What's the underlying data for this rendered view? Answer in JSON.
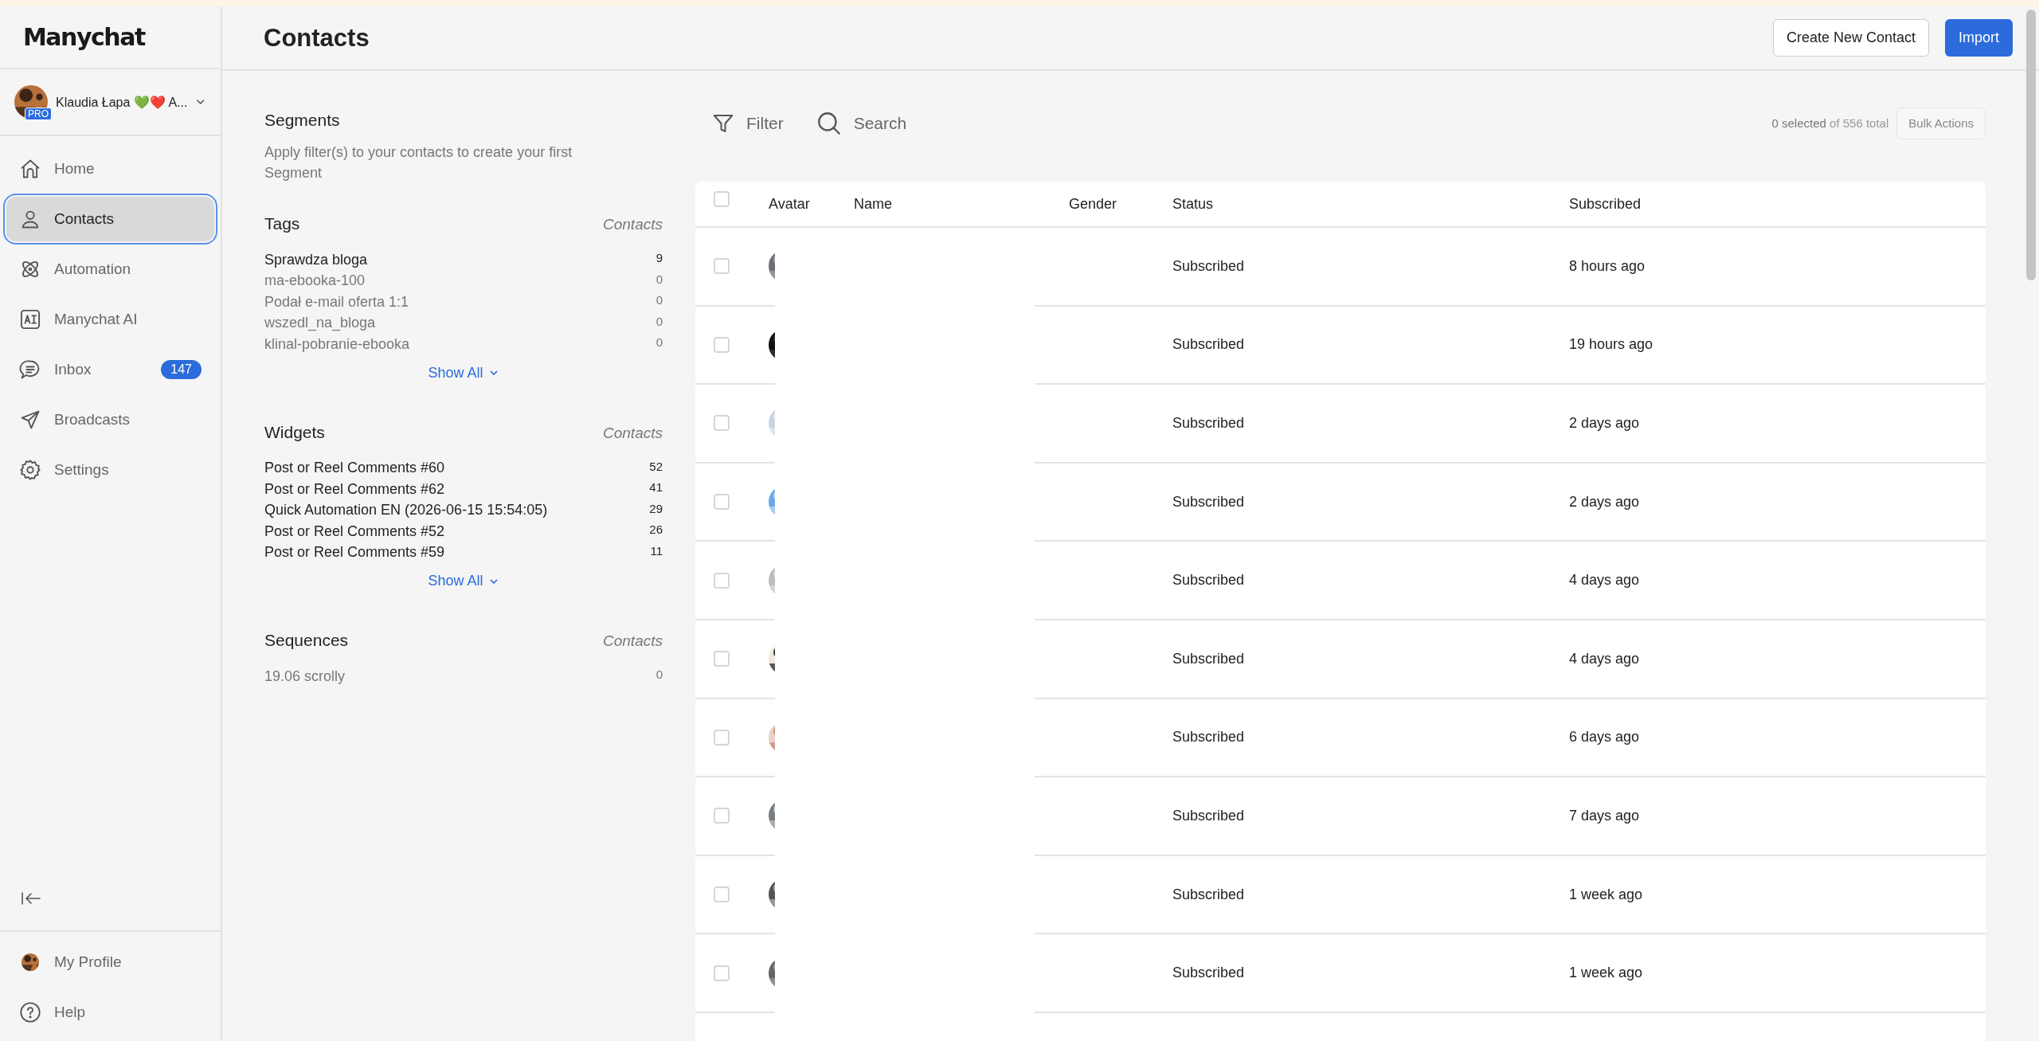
{
  "brand": {
    "logo": "Manychat"
  },
  "account": {
    "name": "Klaudia Łapa 💚❤️ A...",
    "badge": "PRO"
  },
  "nav": [
    {
      "label": "Home",
      "selected": false
    },
    {
      "label": "Contacts",
      "selected": true
    },
    {
      "label": "Automation",
      "selected": false
    },
    {
      "label": "Manychat AI",
      "selected": false
    },
    {
      "label": "Inbox",
      "selected": false,
      "badge": "147"
    },
    {
      "label": "Broadcasts",
      "selected": false
    },
    {
      "label": "Settings",
      "selected": false
    }
  ],
  "bottom_nav": [
    {
      "label": "My Profile"
    },
    {
      "label": "Help"
    }
  ],
  "header": {
    "title": "Contacts",
    "buttons": [
      {
        "label": "Create New Contact",
        "kind": "secondary"
      },
      {
        "label": "Import",
        "kind": "primary"
      }
    ]
  },
  "segments": {
    "title": "Segments",
    "hint": "Apply filter(s) to your contacts to create your first Segment"
  },
  "lists": [
    {
      "title": "Tags",
      "column": "Contacts",
      "show_all": "Show All",
      "items": [
        {
          "label": "Sprawdza bloga",
          "count": "9",
          "dimmed": false
        },
        {
          "label": "ma-ebooka-100",
          "count": "0",
          "dimmed": true
        },
        {
          "label": "Podał e-mail oferta 1:1",
          "count": "0",
          "dimmed": true
        },
        {
          "label": "wszedl_na_bloga",
          "count": "0",
          "dimmed": true
        },
        {
          "label": "klinal-pobranie-ebooka",
          "count": "0",
          "dimmed": true
        }
      ]
    },
    {
      "title": "Widgets",
      "column": "Contacts",
      "show_all": "Show All",
      "items": [
        {
          "label": "Post or Reel Comments #60",
          "count": "52",
          "dimmed": false
        },
        {
          "label": "Post or Reel Comments #62",
          "count": "41",
          "dimmed": false
        },
        {
          "label": "Quick Automation EN (2026-06-15 15:54:05)",
          "count": "29",
          "dimmed": false
        },
        {
          "label": "Post or Reel Comments #52",
          "count": "26",
          "dimmed": false
        },
        {
          "label": "Post or Reel Comments #59",
          "count": "11",
          "dimmed": false
        }
      ]
    },
    {
      "title": "Sequences",
      "column": "Contacts",
      "items": [
        {
          "label": "19.06 scrolly",
          "count": "0",
          "dimmed": true
        }
      ]
    }
  ],
  "toolbar": {
    "filter": "Filter",
    "search": "Search",
    "selected": "0 selected",
    "total": "of 556 total",
    "bulk": "Bulk Actions"
  },
  "table": {
    "columns": [
      "Avatar",
      "Name",
      "Gender",
      "Status",
      "Subscribed"
    ],
    "all_checked": false,
    "rows": [
      {
        "checked": false,
        "status": "Subscribed",
        "subscribed": "8 hours ago"
      },
      {
        "checked": false,
        "status": "Subscribed",
        "subscribed": "19 hours ago"
      },
      {
        "checked": false,
        "status": "Subscribed",
        "subscribed": "2 days ago"
      },
      {
        "checked": false,
        "status": "Subscribed",
        "subscribed": "2 days ago"
      },
      {
        "checked": false,
        "status": "Subscribed",
        "subscribed": "4 days ago"
      },
      {
        "checked": false,
        "status": "Subscribed",
        "subscribed": "4 days ago"
      },
      {
        "checked": false,
        "status": "Subscribed",
        "subscribed": "6 days ago"
      },
      {
        "checked": false,
        "status": "Subscribed",
        "subscribed": "7 days ago"
      },
      {
        "checked": false,
        "status": "Subscribed",
        "subscribed": "1 week ago"
      },
      {
        "checked": false,
        "status": "Subscribed",
        "subscribed": "1 week ago"
      }
    ]
  }
}
